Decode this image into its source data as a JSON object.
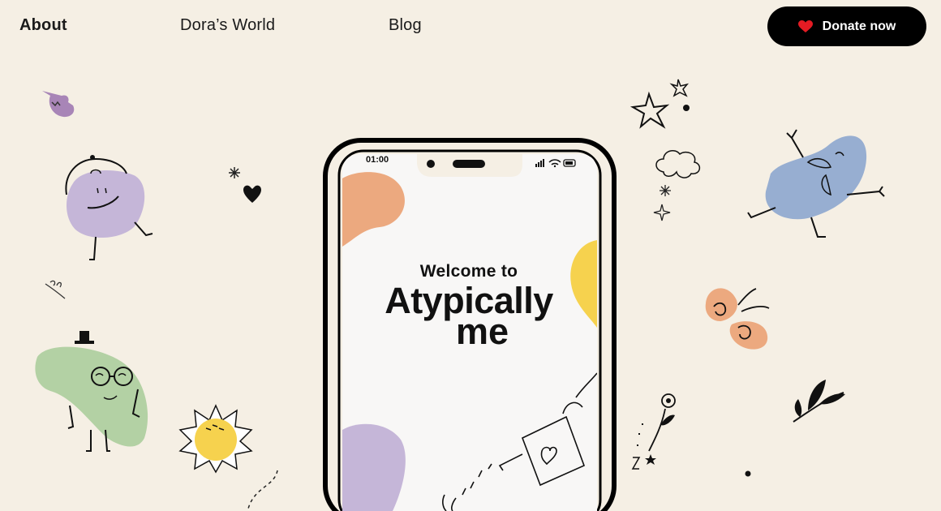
{
  "nav": {
    "about": "About",
    "world": "Dora’s World",
    "blog": "Blog",
    "donate_label": "Donate now"
  },
  "phone": {
    "status_time": "01:00",
    "welcome": "Welcome to",
    "brand_line1": "Atypically",
    "brand_line2": "me"
  },
  "colors": {
    "background": "#f5efe4",
    "button": "#000000",
    "heart": "#e41b23",
    "purple": "#c5b6d8",
    "blue": "#97aed1",
    "green": "#b3d1a4",
    "peach": "#eca97f",
    "yellow": "#f6d24e"
  },
  "icons": [
    "heart-icon",
    "signal-icon",
    "wifi-icon",
    "battery-icon"
  ]
}
